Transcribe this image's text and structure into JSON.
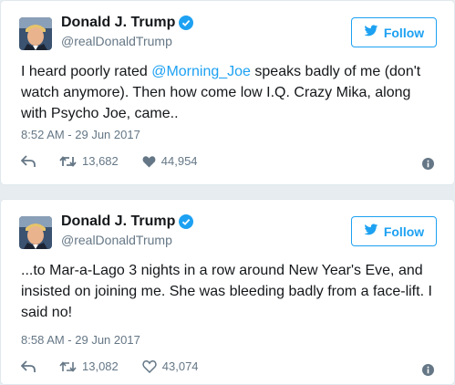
{
  "colors": {
    "accent": "#1da1f2",
    "muted": "#657786",
    "text": "#14171a",
    "divider": "#e1e8ed"
  },
  "tweets": [
    {
      "author_name": "Donald J. Trump",
      "handle": "@realDonaldTrump",
      "follow_label": "Follow",
      "text_before": "I heard poorly rated ",
      "mention": "@Morning_Joe",
      "text_after": " speaks badly of me (don't watch anymore). Then how come low I.Q. Crazy Mika, along with Psycho Joe, came..",
      "timestamp": "8:52 AM - 29 Jun 2017",
      "retweets": "13,682",
      "likes": "44,954",
      "icons": [
        "verified-icon",
        "twitter-bird-icon",
        "reply-icon",
        "retweet-icon",
        "heart-icon",
        "info-icon"
      ]
    },
    {
      "author_name": "Donald J. Trump",
      "handle": "@realDonaldTrump",
      "follow_label": "Follow",
      "text_before": "...to Mar-a-Lago 3 nights in a row around New Year's Eve, and insisted on joining me. She was bleeding badly from a face-lift. I said no!",
      "mention": "",
      "text_after": "",
      "timestamp": "8:58 AM - 29 Jun 2017",
      "retweets": "13,082",
      "likes": "43,074",
      "icons": [
        "verified-icon",
        "twitter-bird-icon",
        "reply-icon",
        "retweet-icon",
        "heart-icon",
        "info-icon"
      ]
    }
  ]
}
